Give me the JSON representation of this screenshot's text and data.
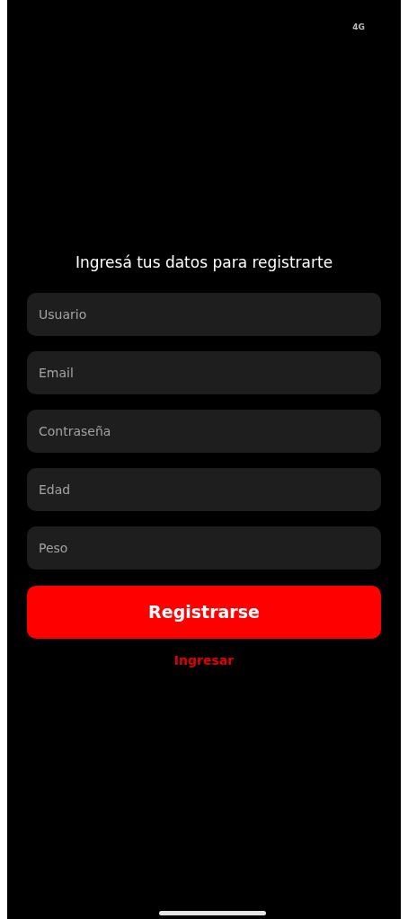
{
  "status_bar": {
    "network": "4G"
  },
  "title": "Ingresá tus datos para registrarte",
  "fields": [
    {
      "placeholder": "Usuario"
    },
    {
      "placeholder": "Email"
    },
    {
      "placeholder": "Contraseña"
    },
    {
      "placeholder": "Edad"
    },
    {
      "placeholder": "Peso"
    }
  ],
  "primary_button": "Registrarse",
  "link": "Ingresar"
}
